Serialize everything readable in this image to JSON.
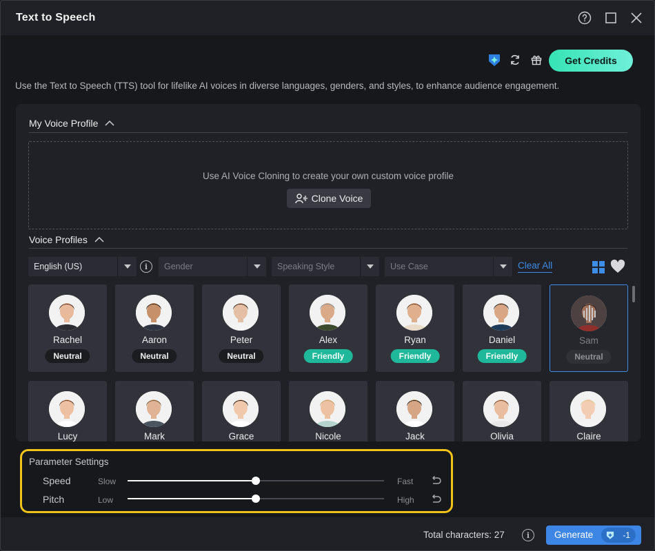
{
  "window": {
    "title": "Text to Speech"
  },
  "toolbar": {
    "get_credits_label": "Get Credits"
  },
  "description": "Use the Text to Speech (TTS) tool for lifelike AI voices in diverse languages, genders, and styles, to enhance audience engagement.",
  "my_voice_profile": {
    "heading": "My Voice Profile",
    "prompt": "Use AI Voice Cloning to create your own custom voice profile",
    "clone_button_label": "Clone Voice"
  },
  "voice_profiles": {
    "heading": "Voice Profiles",
    "filters": {
      "language": "English (US)",
      "gender": "Gender",
      "speaking_style": "Speaking Style",
      "use_case": "Use Case"
    },
    "clear_all_label": "Clear All",
    "cards": [
      {
        "name": "Rachel",
        "style": "Neutral",
        "style_type": "neutral",
        "skin": "#e8b99a",
        "hair": "#5a3424",
        "shirt": "#2b2d33"
      },
      {
        "name": "Aaron",
        "style": "Neutral",
        "style_type": "neutral",
        "skin": "#c6906b",
        "hair": "#3a2418",
        "shirt": "#2f3542"
      },
      {
        "name": "Peter",
        "style": "Neutral",
        "style_type": "neutral",
        "skin": "#e5bfa3",
        "hair": "#3b2a20",
        "shirt": "#f4f4f4"
      },
      {
        "name": "Alex",
        "style": "Friendly",
        "style_type": "friendly",
        "skin": "#d9a988",
        "hair": "#8f8f8f",
        "shirt": "#3c4a2e"
      },
      {
        "name": "Ryan",
        "style": "Friendly",
        "style_type": "friendly",
        "skin": "#e0b08e",
        "hair": "#6b4226",
        "shirt": "#e8dcc8"
      },
      {
        "name": "Daniel",
        "style": "Friendly",
        "style_type": "friendly",
        "skin": "#d8a685",
        "hair": "#2c2c2c",
        "shirt": "#1f3b5c"
      },
      {
        "name": "Sam",
        "style": "Neutral",
        "style_type": "neutral",
        "skin": "#c98c6c",
        "hair": "#3a2418",
        "shirt": "#b5322e"
      },
      {
        "name": "Lucy",
        "style": "",
        "style_type": "none",
        "skin": "#eec0a2",
        "hair": "#6b3f24",
        "shirt": "#ffffff"
      },
      {
        "name": "Mark",
        "style": "",
        "style_type": "none",
        "skin": "#dfb394",
        "hair": "#7b5a3a",
        "shirt": "#4a5560"
      },
      {
        "name": "Grace",
        "style": "",
        "style_type": "none",
        "skin": "#f0c9ad",
        "hair": "#2a1d17",
        "shirt": "#ffffff"
      },
      {
        "name": "Nicole",
        "style": "",
        "style_type": "none",
        "skin": "#edc2a3",
        "hair": "#c99e6c",
        "shirt": "#b4d4cc"
      },
      {
        "name": "Jack",
        "style": "",
        "style_type": "none",
        "skin": "#d6a585",
        "hair": "#3a2618",
        "shirt": "#ffffff"
      },
      {
        "name": "Olivia",
        "style": "",
        "style_type": "none",
        "skin": "#e9bea0",
        "hair": "#7a4a2a",
        "shirt": "#e8e8e8"
      },
      {
        "name": "Claire",
        "style": "",
        "style_type": "none",
        "skin": "#f2cdb3",
        "hair": "#e2c88f",
        "shirt": "#f4f4f4"
      }
    ],
    "selected": "Sam"
  },
  "parameters": {
    "heading": "Parameter Settings",
    "speed": {
      "label": "Speed",
      "min_label": "Slow",
      "max_label": "Fast",
      "value_fraction": 0.5
    },
    "pitch": {
      "label": "Pitch",
      "min_label": "Low",
      "max_label": "High",
      "value_fraction": 0.5
    }
  },
  "footer": {
    "total_characters_label": "Total characters: 27",
    "generate_label": "Generate",
    "generate_cost": "-1"
  },
  "colors": {
    "accent_blue": "#3d8de8",
    "credits_green": "#36e3b4",
    "friendly_badge": "#1fb89a",
    "highlight_border": "#f2c318"
  }
}
